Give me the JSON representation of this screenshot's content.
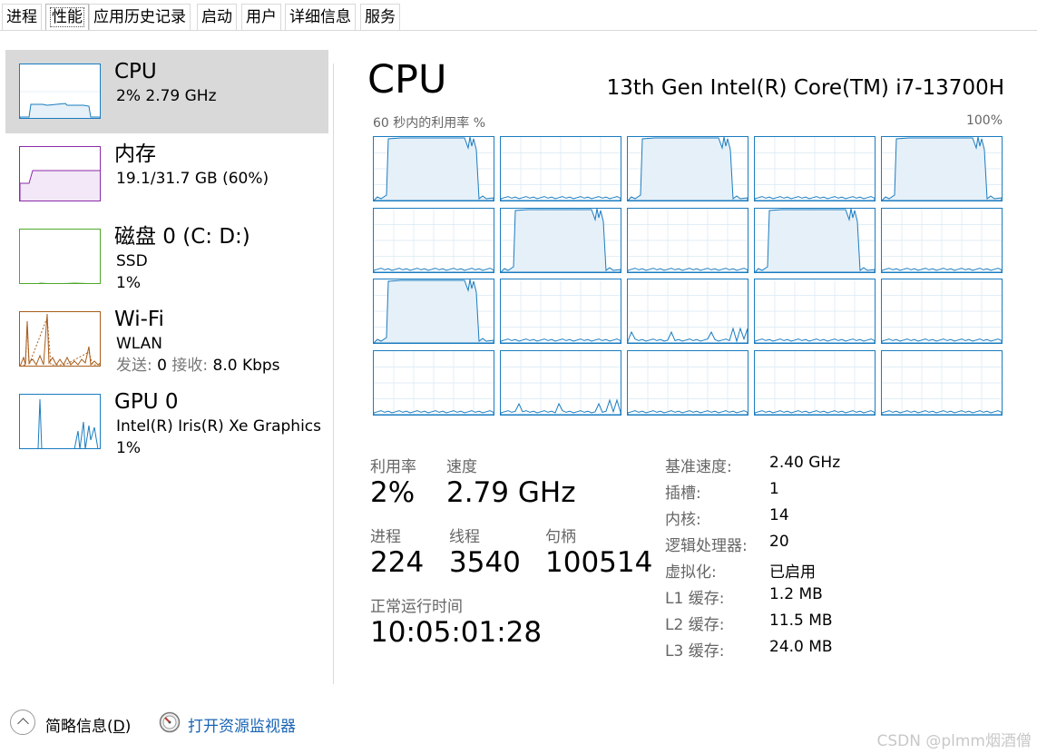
{
  "tabs": [
    "进程",
    "性能",
    "应用历史记录",
    "启动",
    "用户",
    "详细信息",
    "服务"
  ],
  "active_tab": "性能",
  "sidebar": {
    "items": [
      {
        "title": "CPU",
        "sub1": "2%  2.79 GHz",
        "sub2": "",
        "color": "#1a7cc0"
      },
      {
        "title": "内存",
        "sub1": "19.1/31.7 GB (60%)",
        "sub2": "",
        "color": "#8b2aa8"
      },
      {
        "title": "磁盘 0 (C: D:)",
        "sub1": "SSD",
        "sub2": "1%",
        "color": "#4da82a"
      },
      {
        "title": "Wi-Fi",
        "sub1": "WLAN",
        "sub2_label_send": "发送:",
        "sub2_val_send": "0",
        "sub2_label_recv": "接收:",
        "sub2_val_recv": "8.0 Kbps",
        "color": "#a85c1a"
      },
      {
        "title": "GPU 0",
        "sub1": "Intel(R) Iris(R) Xe Graphics",
        "sub2": "1%",
        "color": "#1a7cc0"
      }
    ]
  },
  "main": {
    "title": "CPU",
    "model": "13th Gen Intel(R) Core(TM) i7-13700H",
    "util_label": "60 秒内的利用率 %",
    "max_label": "100%",
    "core_count": 20,
    "core_loads": [
      "high",
      "low",
      "high",
      "low",
      "high",
      "low",
      "high",
      "low",
      "high",
      "low",
      "high",
      "low",
      "low",
      "low",
      "low",
      "low",
      "low",
      "low",
      "low",
      "low"
    ]
  },
  "stats": {
    "util_label": "利用率",
    "util_value": "2%",
    "speed_label": "速度",
    "speed_value": "2.79 GHz",
    "proc_label": "进程",
    "proc_value": "224",
    "threads_label": "线程",
    "threads_value": "3540",
    "handles_label": "句柄",
    "handles_value": "100514",
    "uptime_label": "正常运行时间",
    "uptime_value": "10:05:01:28"
  },
  "specs": [
    {
      "key": "基准速度:",
      "value": "2.40 GHz"
    },
    {
      "key": "插槽:",
      "value": "1"
    },
    {
      "key": "内核:",
      "value": "14"
    },
    {
      "key": "逻辑处理器:",
      "value": "20"
    },
    {
      "key": "虚拟化:",
      "value": "已启用"
    },
    {
      "key": "L1 缓存:",
      "value": "1.2 MB"
    },
    {
      "key": "L2 缓存:",
      "value": "11.5 MB"
    },
    {
      "key": "L3 缓存:",
      "value": "24.0 MB"
    }
  ],
  "footer": {
    "brief": "简略信息(",
    "brief_key": "D",
    "brief_end": ")",
    "monitor": "打开资源监视器",
    "watermark": "CSDN @plmm烟酒僧"
  },
  "colors": {
    "cpu": "#1a7cc0",
    "memory": "#8b2aa8",
    "disk": "#4da82a",
    "wifi": "#a85c1a",
    "link": "#1a64b4"
  }
}
